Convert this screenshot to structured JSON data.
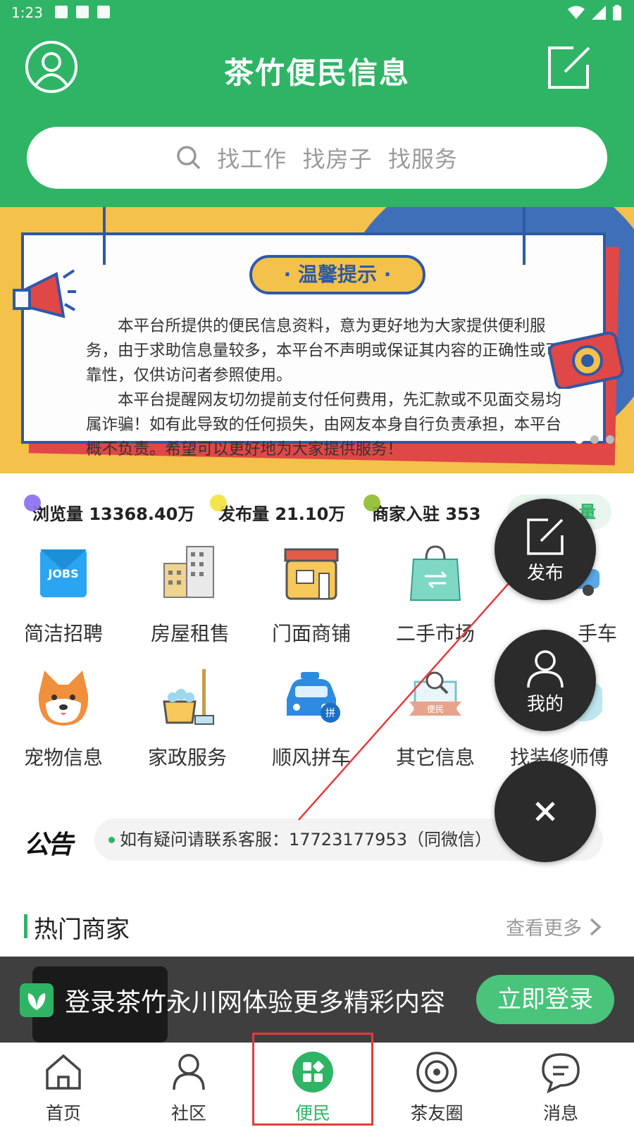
{
  "status_bar": {
    "time": "1:23"
  },
  "header": {
    "title": "茶竹便民信息"
  },
  "search": {
    "placeholder": "找工作  找房子  找服务"
  },
  "banner": {
    "tag": "· 温馨提示 ·",
    "paragraphs": [
      "本平台所提供的便民信息资料，意为更好地为大家提供便利服务，由于求助信息量较多，本平台不声明或保证其内容的正确性或可靠性，仅供访问者参照使用。",
      "本平台提醒网友切勿提前支付任何费用，先汇款或不见面交易均属诈骗！如有此导致的任何损失，由网友本身自行负责承担，本平台概不负责。希望可以更好地为大家提供服务！"
    ]
  },
  "stats": {
    "views": "浏览量 13368.40万",
    "posts": "发布量 21.10万",
    "merchants": "商家入驻 353",
    "more": "量"
  },
  "categories": [
    {
      "label": "简洁招聘",
      "icon": "jobs-icon"
    },
    {
      "label": "房屋租售",
      "icon": "building-icon"
    },
    {
      "label": "门面商铺",
      "icon": "shop-icon"
    },
    {
      "label": "二手市场",
      "icon": "bag-icon"
    },
    {
      "label": "手车",
      "icon": "car-icon"
    },
    {
      "label": "宠物信息",
      "icon": "dog-icon"
    },
    {
      "label": "家政服务",
      "icon": "cleaning-icon"
    },
    {
      "label": "顺风拼车",
      "icon": "taxi-icon"
    },
    {
      "label": "其它信息",
      "icon": "search-badge-icon"
    },
    {
      "label": "找装修师傅",
      "icon": "repair-icon"
    }
  ],
  "announcement": {
    "logo": "公告",
    "text": "如有疑问请联系客服：17723177953（同微信）"
  },
  "hot_merchants": {
    "title": "热门商家",
    "more": "查看更多"
  },
  "login_bar": {
    "text": "登录茶竹永川网体验更多精彩内容",
    "button": "立即登录"
  },
  "fab": {
    "publish": "发布",
    "mine": "我的"
  },
  "tabs": [
    {
      "label": "首页",
      "icon": "home-icon",
      "active": false
    },
    {
      "label": "社区",
      "icon": "community-icon",
      "active": false
    },
    {
      "label": "便民",
      "icon": "services-icon",
      "active": true
    },
    {
      "label": "茶友圈",
      "icon": "circle-icon",
      "active": false
    },
    {
      "label": "消息",
      "icon": "message-icon",
      "active": false
    }
  ],
  "colors": {
    "brand": "#2fb465",
    "annotation": "#e23c3c"
  }
}
